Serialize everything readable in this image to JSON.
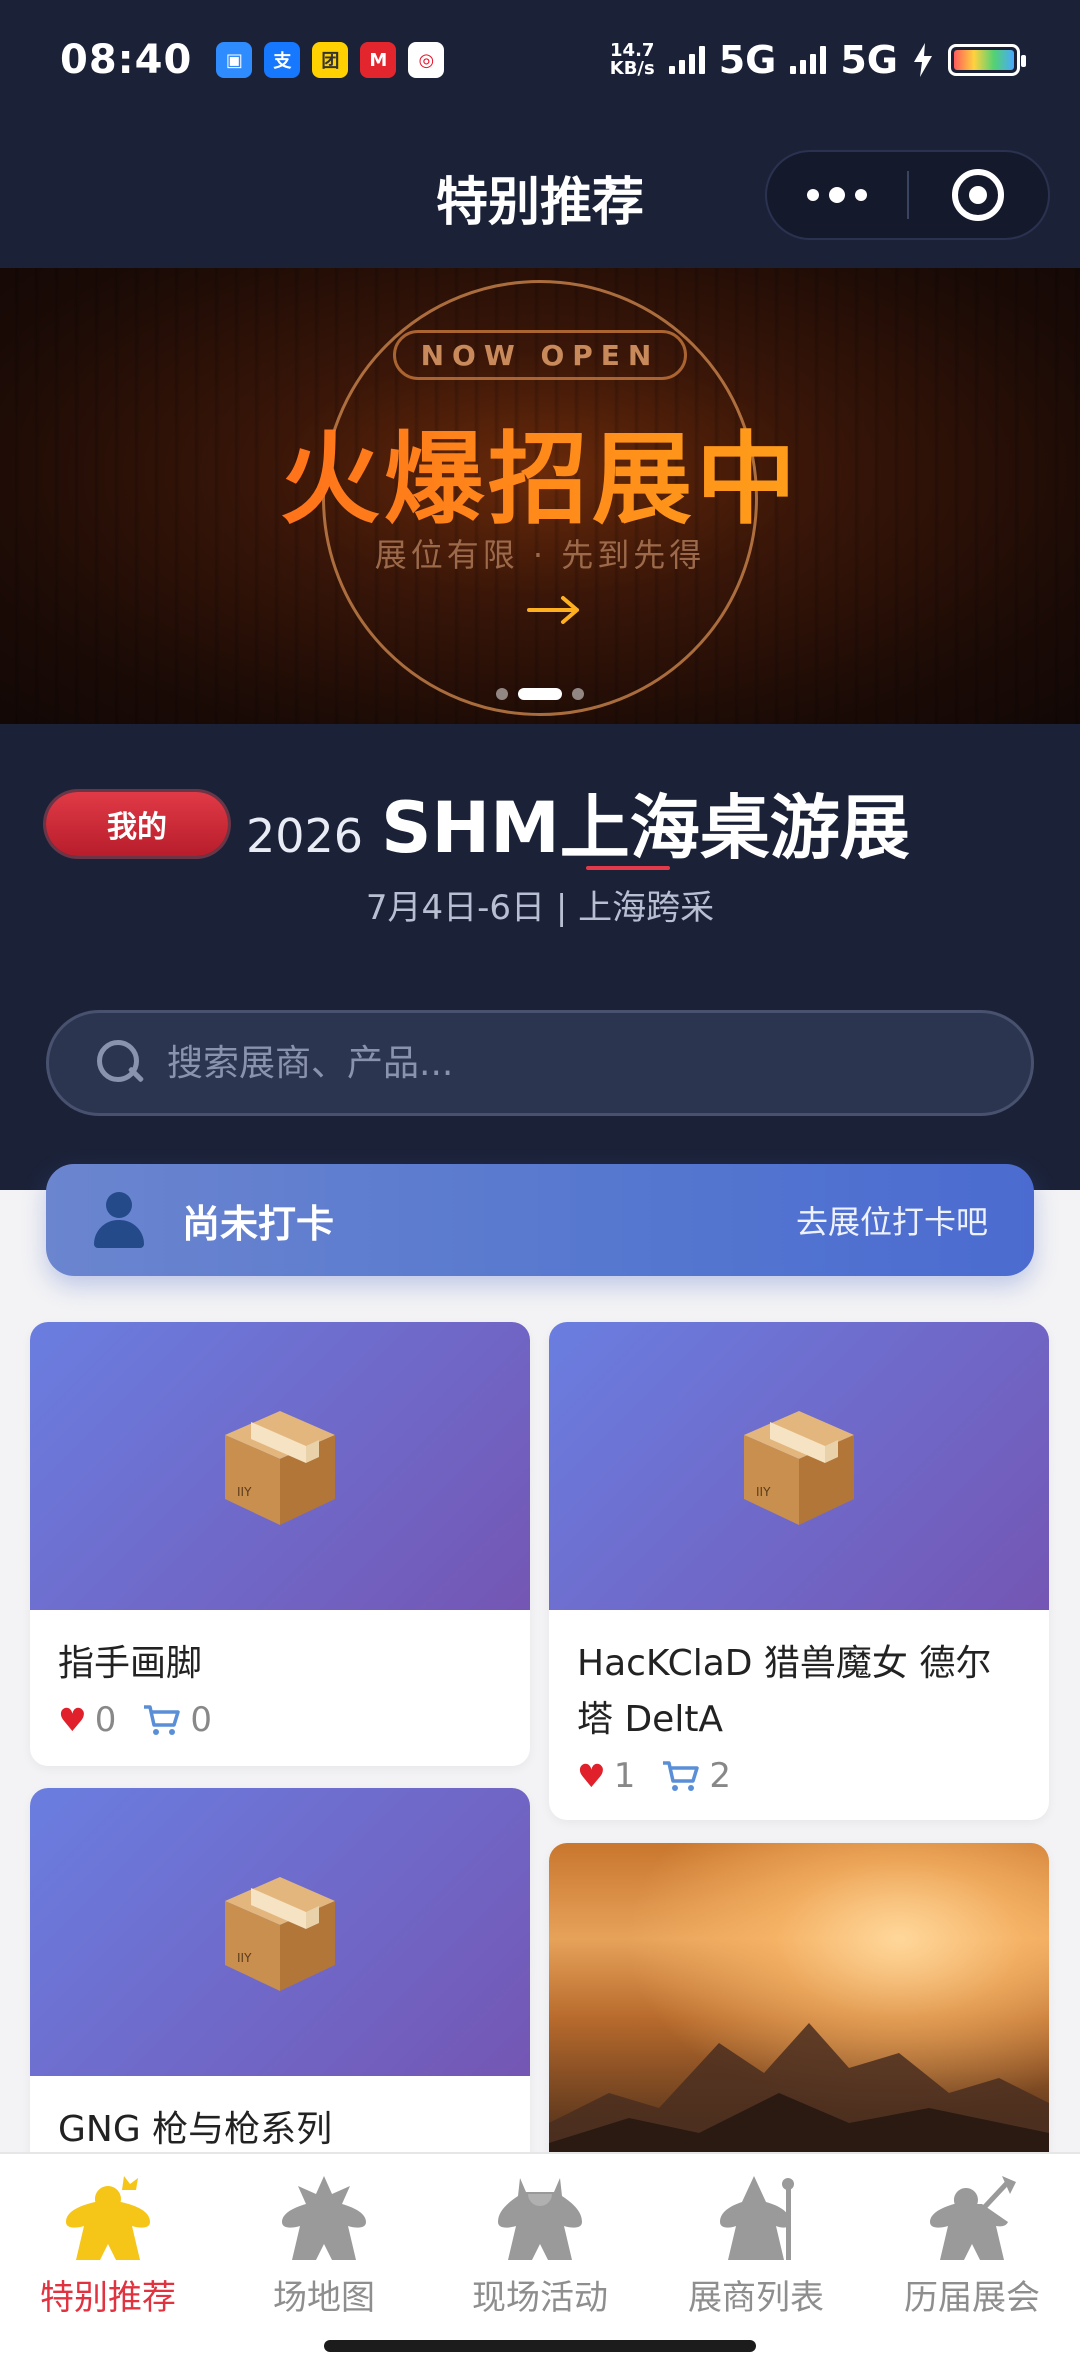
{
  "status_bar": {
    "time": "08:40",
    "net_speed_value": "14.7",
    "net_speed_unit": "KB/s",
    "sim1": "5G",
    "sim2": "5G",
    "app_icons": [
      {
        "name": "message-app",
        "color": "#2f8cff",
        "glyph": "▣"
      },
      {
        "name": "alipay-app",
        "color": "#1677ff",
        "glyph": "支"
      },
      {
        "name": "meituan-app",
        "color": "#ffd100",
        "glyph": "团"
      },
      {
        "name": "cmb-bank-app",
        "color": "#e3262e",
        "glyph": "M"
      },
      {
        "name": "weibo-app",
        "color": "#e6162d",
        "glyph": "◎"
      }
    ],
    "battery_level": 1.0
  },
  "nav": {
    "title": "特别推荐"
  },
  "banner": {
    "tag": "NOW OPEN",
    "headline": "火爆招展中",
    "subtitle": "展位有限 · 先到先得",
    "slide_count": 3,
    "active_slide": 1
  },
  "event": {
    "mine_label": "我的",
    "year": "2026",
    "name": "SHM上海桌游展",
    "date_location": "7月4日-6日 | 上海跨采"
  },
  "search": {
    "placeholder": "搜索展商、产品..."
  },
  "checkin": {
    "status": "尚未打卡",
    "action": "去展位打卡吧"
  },
  "products": [
    {
      "name": "指手画脚",
      "likes": "0",
      "carts": "0"
    },
    {
      "name": "HacKClaD 猎兽魔女 德尔塔 DeltA",
      "likes": "1",
      "carts": "2"
    },
    {
      "name": "GNG 枪与枪系列",
      "likes": "",
      "carts": ""
    },
    {
      "name": "",
      "likes": "",
      "carts": ""
    }
  ],
  "tabs": [
    {
      "label": "特别推荐",
      "icon": "meeple-crown-icon",
      "active": true
    },
    {
      "label": "场地图",
      "icon": "meeple-star-icon",
      "active": false
    },
    {
      "label": "现场活动",
      "icon": "meeple-viking-icon",
      "active": false
    },
    {
      "label": "展商列表",
      "icon": "meeple-wizard-icon",
      "active": false
    },
    {
      "label": "历届展会",
      "icon": "meeple-axe-icon",
      "active": false
    }
  ],
  "colors": {
    "accent_red": "#e0323f",
    "dark_bg": "#1b2238",
    "active_tab_icon": "#f5c518",
    "inactive_tab_icon": "#9a9a9a"
  }
}
